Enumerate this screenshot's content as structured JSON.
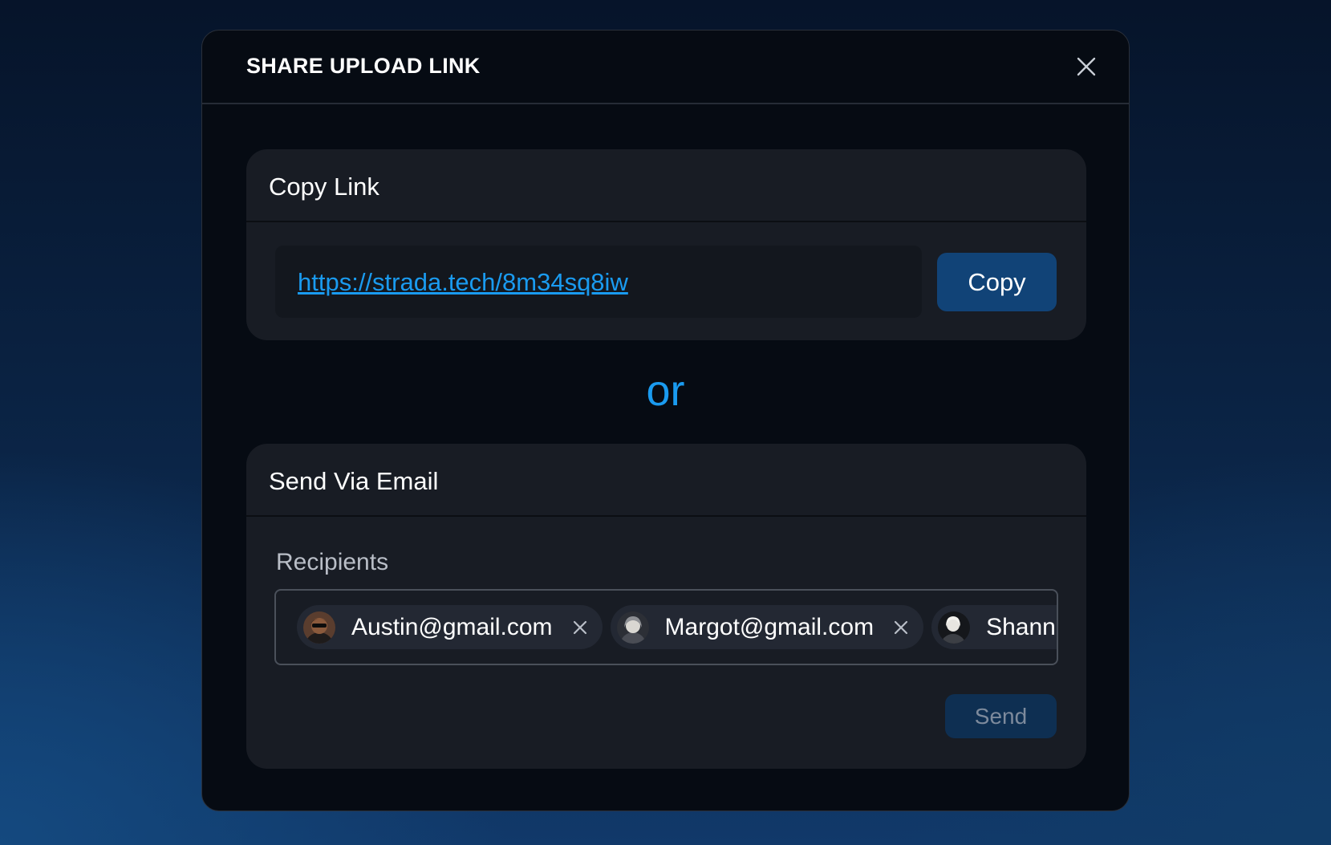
{
  "modal": {
    "title": "SHARE UPLOAD LINK",
    "close_icon": "close-icon"
  },
  "copy_link": {
    "title": "Copy Link",
    "url": "https://strada.tech/8m34sq8iw",
    "copy_label": "Copy"
  },
  "divider_text": "or",
  "send_email": {
    "title": "Send Via Email",
    "recipients_label": "Recipients",
    "recipients": [
      {
        "email": "Austin@gmail.com",
        "avatar": "avatar-photo",
        "remove_icon": "close-icon"
      },
      {
        "email": "Margot@gmail.com",
        "avatar": "avatar-photo",
        "remove_icon": "close-icon"
      },
      {
        "email": "Shanno",
        "avatar": "avatar-photo"
      }
    ],
    "send_label": "Send"
  },
  "colors": {
    "accent": "#1a9bf0",
    "primary_button": "#114377",
    "disabled_button": "#0e2f52",
    "modal_bg": "#060b13",
    "card_bg": "#181c24",
    "chip_bg": "#232833"
  }
}
